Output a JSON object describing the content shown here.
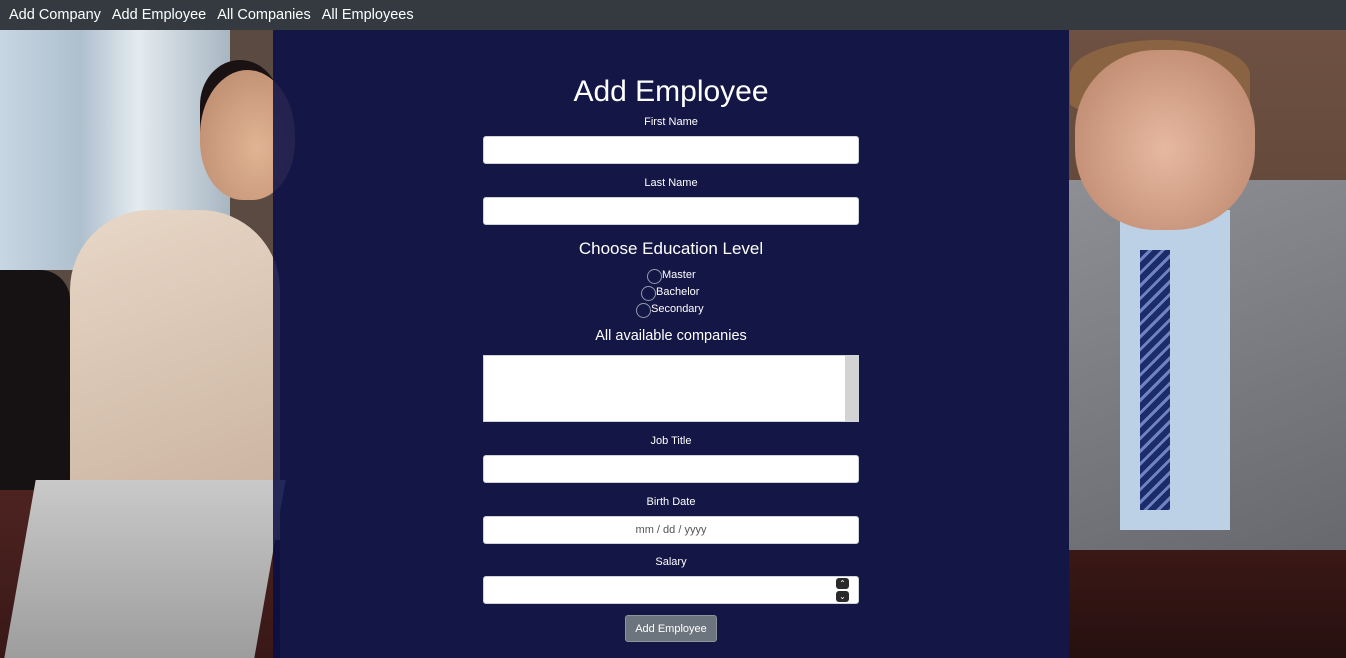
{
  "nav": {
    "items": [
      "Add Company",
      "Add Employee",
      "All Companies",
      "All Employees"
    ]
  },
  "form": {
    "title": "Add Employee",
    "first_name_label": "First Name",
    "first_name_value": "",
    "last_name_label": "Last Name",
    "last_name_value": "",
    "education_title": "Choose Education Level",
    "education_options": [
      "Master",
      "Bachelor",
      "Secondary"
    ],
    "companies_title": "All available companies",
    "companies_options": [],
    "job_title_label": "Job Title",
    "job_title_value": "",
    "birth_date_label": "Birth Date",
    "birth_date_placeholder": "mm / dd / yyyy",
    "salary_label": "Salary",
    "salary_value": "",
    "submit_label": "Add Employee"
  },
  "colors": {
    "navbar": "#343a40",
    "panel_overlay": "#080e46",
    "button": "#6c757d"
  },
  "icons": {
    "spinner_up": "chevron-up-icon",
    "spinner_down": "chevron-down-icon"
  }
}
